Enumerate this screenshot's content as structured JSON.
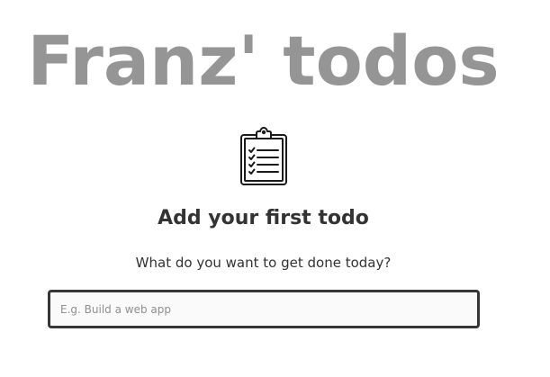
{
  "app": {
    "title": "Franz' todos"
  },
  "empty_state": {
    "icon": "clipboard-checklist-icon",
    "heading": "Add your first todo",
    "subtext": "What do you want to get done today?"
  },
  "new_todo": {
    "value": "",
    "placeholder": "E.g. Build a web app"
  },
  "colors": {
    "title": "#959595",
    "text": "#333333",
    "input_border": "#363636",
    "input_background": "#fafafa",
    "placeholder": "#8f8f8f"
  }
}
